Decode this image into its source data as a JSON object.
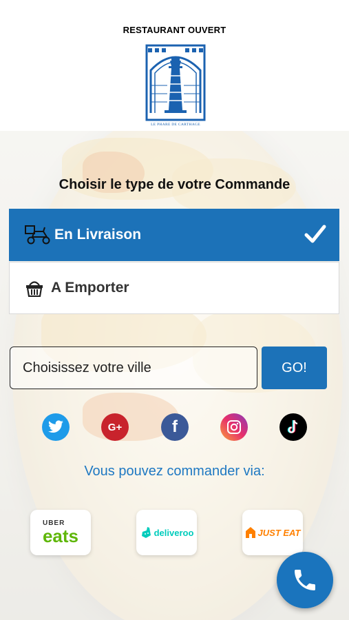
{
  "header": {
    "status": "RESTAURANT OUVERT",
    "logo_text": "LE PHARE DE CARTHAGE"
  },
  "order": {
    "title": "Choisir le type de votre Commande",
    "options": [
      {
        "label": "En Livraison",
        "icon": "delivery-scooter-icon",
        "selected": true
      },
      {
        "label": "A Emporter",
        "icon": "basket-icon",
        "selected": false
      }
    ]
  },
  "city": {
    "placeholder": "Choisissez votre ville",
    "button": "GO!"
  },
  "social": [
    "twitter-icon",
    "google-plus-icon",
    "facebook-icon",
    "instagram-icon",
    "tiktok-icon"
  ],
  "partners": {
    "heading": "Vous pouvez commander via:",
    "items": [
      {
        "top": "UBER",
        "name": "eats"
      },
      {
        "name": "deliveroo"
      },
      {
        "name": "JUST EAT"
      }
    ]
  },
  "colors": {
    "primary": "#1c72b8",
    "link": "#1e78c2",
    "ubereats_green": "#5fb709",
    "deliveroo": "#00ccbc",
    "justeat": "#ff8000"
  }
}
